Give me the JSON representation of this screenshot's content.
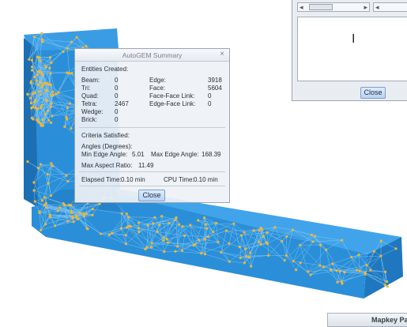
{
  "dialog": {
    "title": "AutoGEM Summary",
    "close_x": "×",
    "entities_heading": "Entities Created:",
    "left_rows": [
      {
        "label": "Beam:",
        "value": "0"
      },
      {
        "label": "Tri:",
        "value": "0"
      },
      {
        "label": "Quad:",
        "value": "0"
      },
      {
        "label": "Tetra:",
        "value": "2467"
      },
      {
        "label": "Wedge:",
        "value": "0"
      },
      {
        "label": "Brick:",
        "value": "0"
      }
    ],
    "right_rows": [
      {
        "label": "Edge:",
        "value": "3918"
      },
      {
        "label": "Face:",
        "value": "5604"
      },
      {
        "label": "Face-Face Link:",
        "value": "0"
      },
      {
        "label": "Edge-Face Link:",
        "value": "0"
      }
    ],
    "criteria_heading": "Criteria Satisfied:",
    "angles_heading": "Angles (Degrees):",
    "min_edge_label": "Min Edge Angle:",
    "min_edge_value": "5.01",
    "max_edge_label": "Max Edge Angle:",
    "max_edge_value": "168.39",
    "aspect_label": "Max Aspect Ratio:",
    "aspect_value": "11.49",
    "elapsed_label": "Elapsed Time:",
    "elapsed_value": "0.10 min",
    "cpu_label": "CPU Time:",
    "cpu_value": "0.10 min",
    "close_button": "Close"
  },
  "background_window": {
    "close_button": "Close",
    "caret_glyph": "I",
    "scroll_arrow_left": "◂",
    "scroll_arrow_right": "▸"
  },
  "status_bar": {
    "mapkey_label": "Mapkey Pa"
  },
  "colors": {
    "model_fill": "#2a8fd8",
    "model_dark": "#1c6fb3",
    "mesh_lines": "#7fc3f0",
    "mesh_nodes": "#f2b634",
    "dialog_bg": "#eef1f5",
    "button_bg": "#c6dcf7"
  }
}
